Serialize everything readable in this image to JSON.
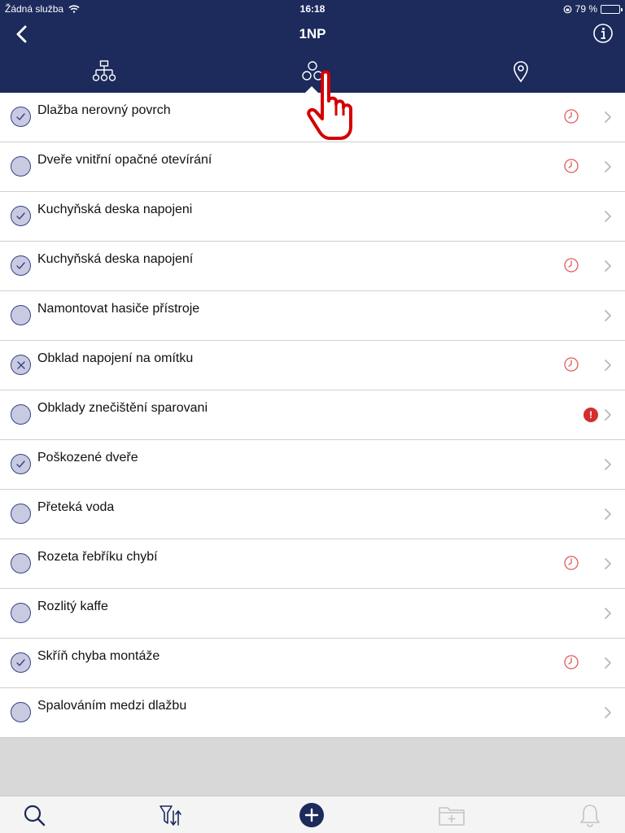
{
  "status_bar": {
    "carrier": "Žádná služba",
    "time": "16:18",
    "battery": "79 %",
    "battery_level": 0.79
  },
  "navbar": {
    "title": "1NP"
  },
  "tabs": [
    {
      "name": "hierarchy-icon"
    },
    {
      "name": "groups-icon",
      "active": true
    },
    {
      "name": "location-pin-icon"
    }
  ],
  "items": [
    {
      "label": "Dlažba nerovný povrch",
      "status": "done",
      "clock": true,
      "alert": false
    },
    {
      "label": "Dveře vnitřní opačné otevírání",
      "status": "open",
      "clock": true,
      "alert": false
    },
    {
      "label": "Kuchyňská deska napojeni",
      "status": "done",
      "clock": false,
      "alert": false
    },
    {
      "label": "Kuchyňská deska napojení",
      "status": "done",
      "clock": true,
      "alert": false
    },
    {
      "label": "Namontovat hasiče přístroje",
      "status": "open",
      "clock": false,
      "alert": false
    },
    {
      "label": "Obklad napojení na omítku",
      "status": "rejected",
      "clock": true,
      "alert": false
    },
    {
      "label": "Obklady znečištění sparovani",
      "status": "open",
      "clock": false,
      "alert": true,
      "alert_text": "!"
    },
    {
      "label": "Poškozené dveře",
      "status": "done",
      "clock": false,
      "alert": false
    },
    {
      "label": "Přeteká voda",
      "status": "open",
      "clock": false,
      "alert": false
    },
    {
      "label": "Rozeta řebříku chybí",
      "status": "open",
      "clock": true,
      "alert": false
    },
    {
      "label": "Rozlitý kaffe",
      "status": "open",
      "clock": false,
      "alert": false
    },
    {
      "label": "Skříň chyba montáže",
      "status": "done",
      "clock": true,
      "alert": false
    },
    {
      "label": "Spalováním medzi dlažbu",
      "status": "open",
      "clock": false,
      "alert": false
    }
  ],
  "bottom_bar": [
    {
      "name": "search-icon"
    },
    {
      "name": "filter-sort-icon"
    },
    {
      "name": "add-icon"
    },
    {
      "name": "folder-add-icon",
      "disabled": true
    },
    {
      "name": "bell-icon",
      "disabled": true
    }
  ],
  "colors": {
    "header": "#1c2a5c",
    "status_fill": "#c8cbe0",
    "status_stroke": "#34418a",
    "alert": "#d32f2f",
    "clock": "#e05a5a"
  }
}
